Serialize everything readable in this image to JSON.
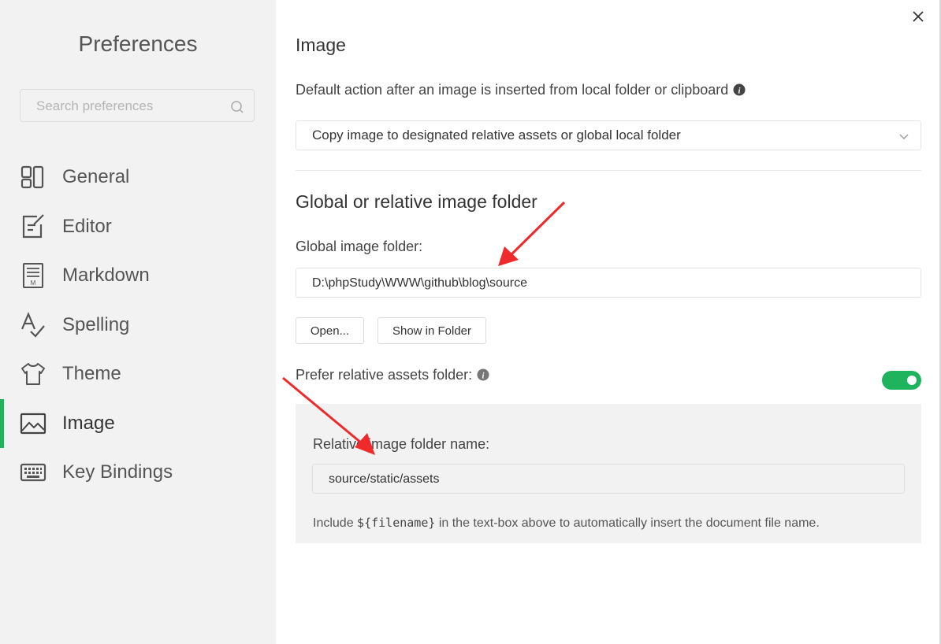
{
  "sidebar": {
    "title": "Preferences",
    "search_placeholder": "Search preferences",
    "items": [
      {
        "label": "General",
        "icon": "general-icon"
      },
      {
        "label": "Editor",
        "icon": "editor-icon"
      },
      {
        "label": "Markdown",
        "icon": "markdown-icon"
      },
      {
        "label": "Spelling",
        "icon": "spelling-icon"
      },
      {
        "label": "Theme",
        "icon": "theme-icon"
      },
      {
        "label": "Image",
        "icon": "image-icon",
        "active": true
      },
      {
        "label": "Key Bindings",
        "icon": "keyboard-icon"
      }
    ]
  },
  "main": {
    "section_title": "Image",
    "default_action_label": "Default action after an image is inserted from local folder or clipboard",
    "default_action_value": "Copy image to designated relative assets or global local folder",
    "folder_section_title": "Global or relative image folder",
    "global_folder_label": "Global image folder:",
    "global_folder_value": "D:\\phpStudy\\WWW\\github\\blog\\source",
    "open_button": "Open...",
    "show_in_folder_button": "Show in Folder",
    "prefer_relative_label": "Prefer relative assets folder:",
    "prefer_relative_enabled": true,
    "relative_folder_label": "Relative image folder name:",
    "relative_folder_value": "source/static/assets",
    "hint_prefix": "Include ",
    "hint_code": "${filename}",
    "hint_suffix": " in the text-box above to automatically insert the document file name."
  },
  "colors": {
    "accent": "#1fb35e",
    "annotation_arrow": "#f02a2a",
    "sidebar_bg": "#f2f2f2"
  }
}
